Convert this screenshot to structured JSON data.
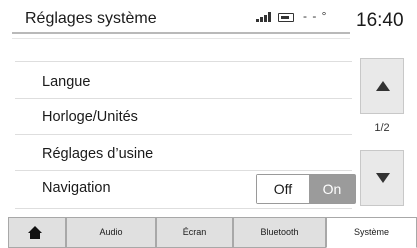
{
  "header": {
    "title": "Réglages système",
    "temperature": "- - °",
    "clock": "16:40",
    "icons": [
      "signal-icon",
      "battery-icon"
    ]
  },
  "menu": {
    "items": [
      {
        "label": "Langue"
      },
      {
        "label": "Horloge/Unités"
      },
      {
        "label": "Réglages d’usine"
      },
      {
        "label": "Navigation"
      }
    ],
    "navigation_toggle": {
      "off_label": "Off",
      "on_label": "On",
      "selected": "On"
    }
  },
  "scroll": {
    "page_indicator": "1/2",
    "up_icon": "arrow-up-icon",
    "down_icon": "arrow-down-icon"
  },
  "tabs": {
    "home_icon": "home-icon",
    "items": [
      {
        "label": "Audio"
      },
      {
        "label": "Écran"
      },
      {
        "label": "Bluetooth"
      },
      {
        "label": "Système"
      }
    ],
    "active": "Système"
  },
  "colors": {
    "toggle_on_bg": "#9b9b9b",
    "tab_bg": "#e0e0e0",
    "scroll_btn_bg": "#e9e9e9"
  }
}
